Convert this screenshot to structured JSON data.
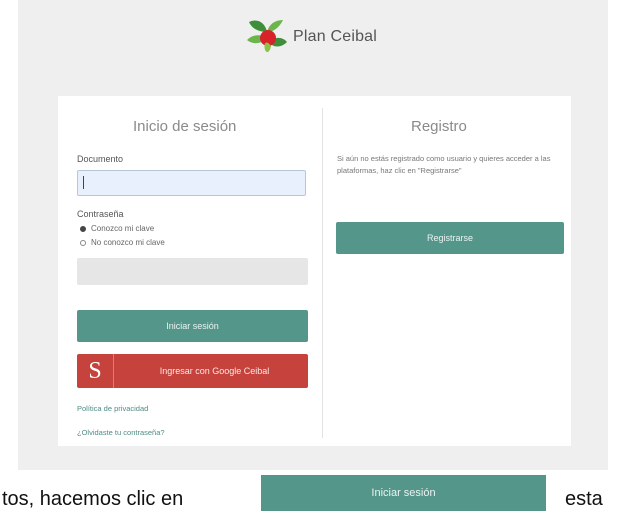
{
  "brand": {
    "name": "Plan Ceibal"
  },
  "login": {
    "title": "Inicio de sesión",
    "document_label": "Documento",
    "document_value": "",
    "password_label": "Contraseña",
    "radio_known": "Conozco mi clave",
    "radio_unknown": "No conozco mi clave",
    "login_button": "Iniciar sesión",
    "google_icon": "S",
    "google_button": "Ingresar con Google Ceibal",
    "privacy_link": "Política de privacidad",
    "forgot_link": "¿Olvidaste tu contraseña?"
  },
  "register": {
    "title": "Registro",
    "text": "Si aún no estás registrado como usuario y quieres acceder a las plataformas, haz clic en \"Registrarse\"",
    "button": "Registrarse"
  },
  "caption": {
    "before": "tos, hacemos clic en",
    "button": "Iniciar sesión",
    "after": "esta"
  },
  "colors": {
    "primary": "#55968b",
    "google": "#c5433c",
    "background": "#efefef"
  }
}
